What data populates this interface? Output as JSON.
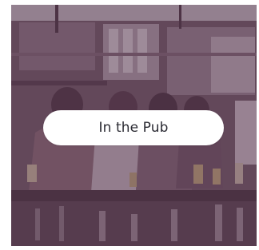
{
  "card": {
    "label": "In the Pub",
    "image_subject": "people-at-bar-counter-photo",
    "overlay_color": "#5c3852"
  }
}
